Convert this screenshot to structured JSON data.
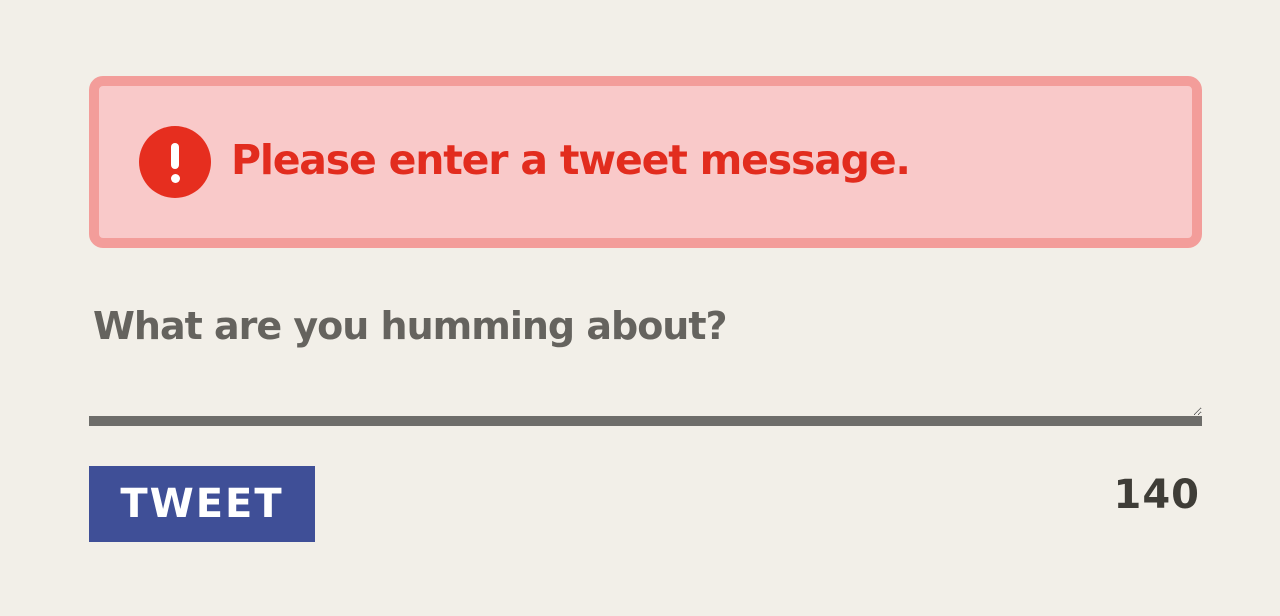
{
  "alert": {
    "icon": "exclamation-circle-icon",
    "message": "Please enter a tweet message."
  },
  "compose": {
    "placeholder": "What are you humming about?",
    "value": ""
  },
  "actions": {
    "tweet_label": "TWEET",
    "char_count": "140"
  },
  "colors": {
    "background": "#f2efe8",
    "alert_fill": "#f9c9c9",
    "alert_border": "#f39d9a",
    "alert_text": "#e22c1e",
    "button": "#3f4f97",
    "underline": "#6e6d6a"
  }
}
